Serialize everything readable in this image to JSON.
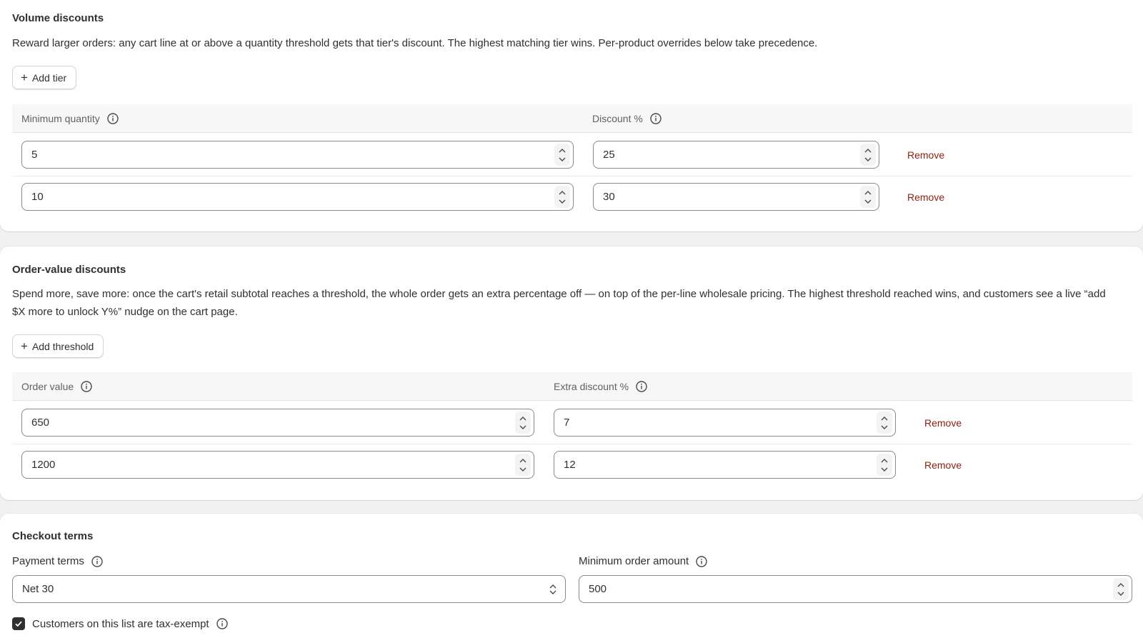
{
  "volume": {
    "title": "Volume discounts",
    "description": "Reward larger orders: any cart line at or above a quantity threshold gets that tier's discount. The highest matching tier wins. Per-product overrides below take precedence.",
    "add_label": "Add tier",
    "headers": {
      "min_quantity": "Minimum quantity",
      "discount": "Discount %"
    },
    "rows": [
      {
        "min_quantity": "5",
        "discount": "25",
        "remove_label": "Remove"
      },
      {
        "min_quantity": "10",
        "discount": "30",
        "remove_label": "Remove"
      }
    ]
  },
  "order_value": {
    "title": "Order-value discounts",
    "description": "Spend more, save more: once the cart's retail subtotal reaches a threshold, the whole order gets an extra percentage off — on top of the per-line wholesale pricing. The highest threshold reached wins, and customers see a live “add $X more to unlock Y%” nudge on the cart page.",
    "add_label": "Add threshold",
    "headers": {
      "order_value": "Order value",
      "extra_discount": "Extra discount %"
    },
    "rows": [
      {
        "order_value": "650",
        "extra_discount": "7",
        "remove_label": "Remove"
      },
      {
        "order_value": "1200",
        "extra_discount": "12",
        "remove_label": "Remove"
      }
    ]
  },
  "checkout": {
    "title": "Checkout terms",
    "payment_terms_label": "Payment terms",
    "payment_terms_value": "Net 30",
    "min_order_label": "Minimum order amount",
    "min_order_value": "500",
    "tax_exempt_label": "Customers on this list are tax-exempt",
    "tax_exempt_checked": true
  },
  "colors": {
    "remove": "#8e1f0b",
    "checkbox": "#303030",
    "table_header_bg": "#f7f7f7"
  },
  "icons": {
    "info": "info-circle-icon",
    "plus": "plus-icon",
    "stepper": "chevron-up-down-icon",
    "select": "select-chevron-icon",
    "check": "checkmark-icon"
  }
}
